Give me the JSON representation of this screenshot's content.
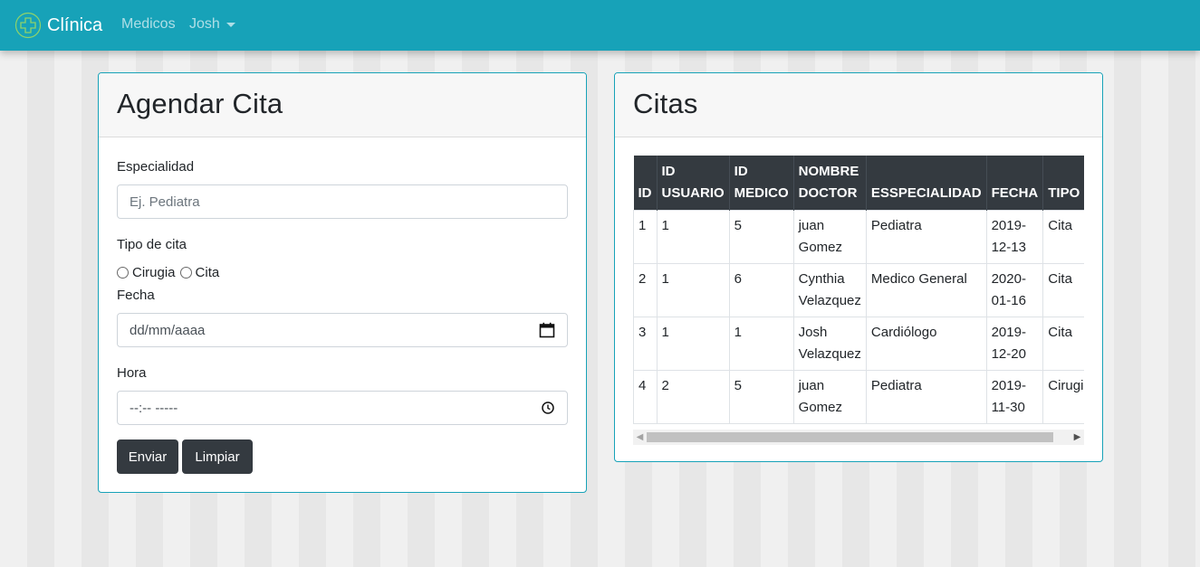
{
  "navbar": {
    "brand": "Clínica",
    "links": [
      {
        "label": "Medicos"
      }
    ],
    "user": "Josh",
    "accent_color": "#17a2b8"
  },
  "appointment_form": {
    "title": "Agendar Cita",
    "especialidad": {
      "label": "Especialidad",
      "placeholder": "Ej. Pediatra",
      "value": ""
    },
    "tipo": {
      "label": "Tipo de cita",
      "options": [
        "Cirugia",
        "Cita"
      ],
      "selected": null
    },
    "fecha": {
      "label": "Fecha",
      "placeholder": "dd/mm/aaaa",
      "icon": "calendar-icon"
    },
    "hora": {
      "label": "Hora",
      "placeholder": "--:-- -----",
      "icon": "clock-icon"
    },
    "buttons": {
      "submit": "Enviar",
      "clear": "Limpiar"
    }
  },
  "appointments": {
    "title": "Citas",
    "columns": [
      "ID",
      "ID USUARIO",
      "ID MEDICO",
      "NOMBRE DOCTOR",
      "ESSPECIALIDAD",
      "FECHA",
      "TIPO"
    ],
    "rows": [
      [
        "1",
        "1",
        "5",
        "juan Gomez",
        "Pediatra",
        "2019-12-13",
        "Cita"
      ],
      [
        "2",
        "1",
        "6",
        "Cynthia Velazquez",
        "Medico General",
        "2020-01-16",
        "Cita"
      ],
      [
        "3",
        "1",
        "1",
        "Josh Velazquez",
        "Cardiólogo",
        "2019-12-20",
        "Cita"
      ],
      [
        "4",
        "2",
        "5",
        "juan Gomez",
        "Pediatra",
        "2019-11-30",
        "Cirugia"
      ]
    ]
  }
}
